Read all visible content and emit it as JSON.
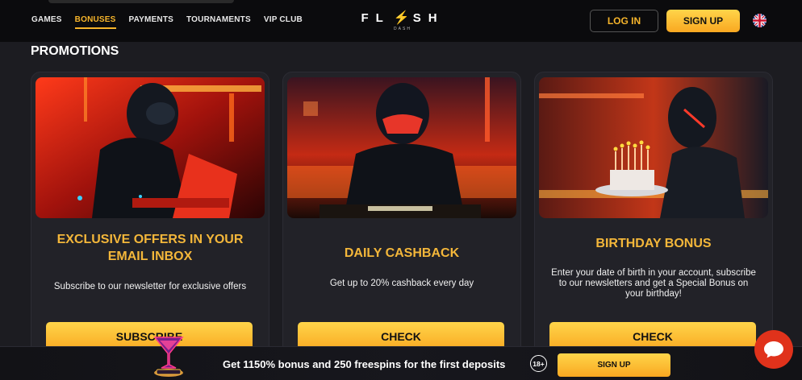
{
  "header": {
    "nav": [
      "GAMES",
      "BONUSES",
      "PAYMENTS",
      "TOURNAMENTS",
      "VIP CLUB"
    ],
    "active_nav": "BONUSES",
    "logo_left": "FL",
    "logo_right": "SH",
    "logo_sub": "DASH",
    "login_label": "LOG IN",
    "signup_label": "SIGN UP",
    "language_icon": "uk-flag-icon"
  },
  "page": {
    "section_title": "PROMOTIONS"
  },
  "cards": [
    {
      "title": "EXCLUSIVE OFFERS IN YOUR EMAIL INBOX",
      "description": "Subscribe to our newsletter for exclusive offers",
      "button": "SUBSCRIBE"
    },
    {
      "title": "DAILY CASHBACK",
      "description": "Get up to 20% cashback every day",
      "button": "CHECK"
    },
    {
      "title": "BIRTHDAY BONUS",
      "description": "Enter your date of birth in your account, subscribe to our newsletters and get a Special Bonus on your birthday!",
      "button": "CHECK"
    }
  ],
  "bottom_bar": {
    "text": "Get 1150% bonus and 250 freespins for the first deposits",
    "age": "18+",
    "signup_label": "SIGN UP"
  },
  "colors": {
    "accent": "#f7b52b",
    "background": "#1c1c21",
    "chat": "#e0321b"
  }
}
